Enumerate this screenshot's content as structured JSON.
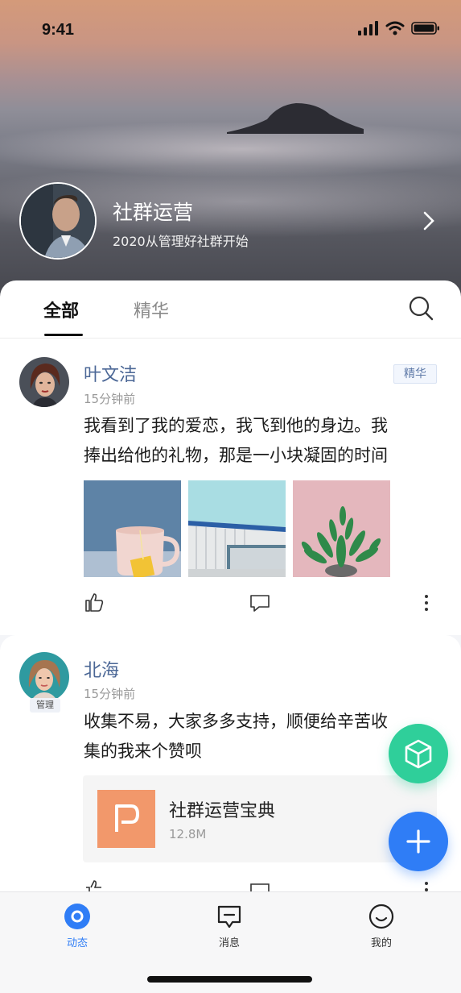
{
  "status_bar": {
    "time": "9:41"
  },
  "group": {
    "title": "社群运营",
    "subtitle": "2020从管理好社群开始"
  },
  "tabs": [
    {
      "label": "全部",
      "active": true
    },
    {
      "label": "精华",
      "active": false
    }
  ],
  "posts": [
    {
      "author": "叶文洁",
      "time": "15分钟前",
      "badge": "精华",
      "text_lines": [
        "我看到了我的爱恋，我飞到他的身边。我",
        "捧出给他的礼物，那是一小块凝固的时间"
      ],
      "images": [
        "pink-mug-photo",
        "building-photo",
        "succulent-photo"
      ]
    },
    {
      "author": "北海",
      "role_tag": "管理",
      "time": "15分钟前",
      "text_lines": [
        "收集不易，大家多多支持，顺便给辛苦收",
        "集的我来个赞呗"
      ],
      "file": {
        "name": "社群运营宝典",
        "size": "12.8M",
        "icon": "ppt-file-icon"
      }
    }
  ],
  "tab_bar": [
    {
      "label": "动态",
      "icon": "activity-icon",
      "active": true
    },
    {
      "label": "消息",
      "icon": "message-icon",
      "active": false
    },
    {
      "label": "我的",
      "icon": "profile-smile-icon",
      "active": false
    }
  ],
  "colors": {
    "accent_blue": "#2f7df6",
    "accent_green": "#2fcf9a",
    "author_name": "#4b6796",
    "file_orange": "#f2986b"
  }
}
